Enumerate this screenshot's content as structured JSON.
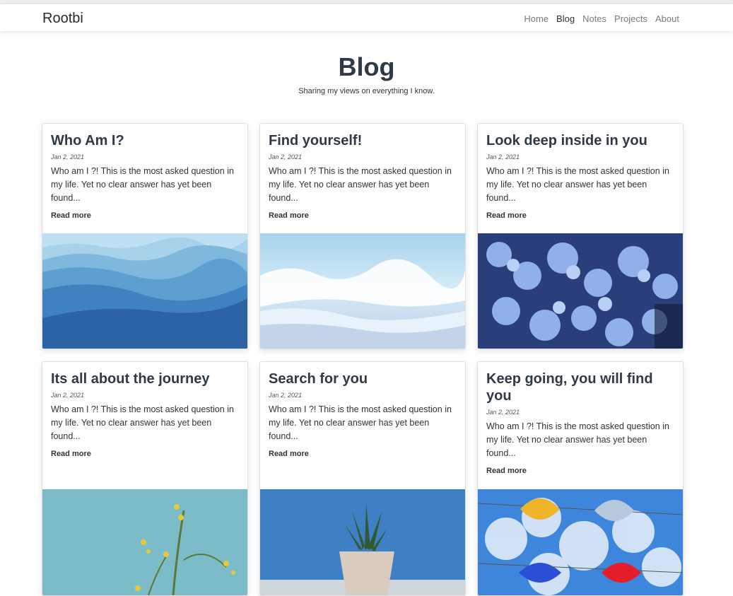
{
  "nav": {
    "brand": "Rootbi",
    "links": [
      "Home",
      "Blog",
      "Notes",
      "Projects",
      "About"
    ],
    "active": "Blog"
  },
  "hero": {
    "title": "Blog",
    "subtitle": "Sharing my views on everything I know."
  },
  "posts": [
    {
      "title": "Who Am I?",
      "date": "Jan 2, 2021",
      "excerpt": "Who am I ?! This is the most asked question in my life. Yet no clear answer has yet been found...",
      "read_more": "Read more",
      "image": "blue-mountains-image"
    },
    {
      "title": "Find yourself!",
      "date": "Jan 2, 2021",
      "excerpt": "Who am I ?! This is the most asked question in my life. Yet no clear answer has yet been found...",
      "read_more": "Read more",
      "image": "ocean-wave-image"
    },
    {
      "title": "Look deep inside in you",
      "date": "Jan 2, 2021",
      "excerpt": "Who am I ?! This is the most asked question in my life. Yet no clear answer has yet been found...",
      "read_more": "Read more",
      "image": "blue-hydrangea-image"
    },
    {
      "title": "Its all about the journey",
      "date": "Jan 2, 2021",
      "excerpt": "Who am I ?! This is the most asked question in my life. Yet no clear answer has yet been found...",
      "read_more": "Read more",
      "image": "yellow-flowers-image"
    },
    {
      "title": "Search for you",
      "date": "Jan 2, 2021",
      "excerpt": "Who am I ?! This is the most asked question in my life. Yet no clear answer has yet been found...",
      "read_more": "Read more",
      "image": "cactus-pot-image"
    },
    {
      "title": "Keep going, you will find you",
      "date": "Jan 2, 2021",
      "excerpt": "Who am I ?! This is the most asked question in my life. Yet no clear answer has yet been found...",
      "read_more": "Read more",
      "image": "umbrellas-sky-image"
    }
  ],
  "colors": {
    "heading": "#2f3a46",
    "nav_text": "#7a7a7a",
    "nav_active": "#333333"
  }
}
